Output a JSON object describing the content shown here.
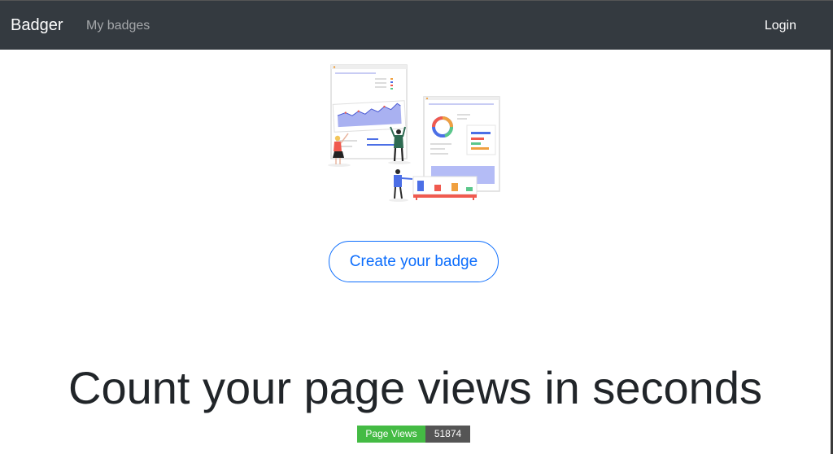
{
  "navbar": {
    "brand": "Badger",
    "links": [
      {
        "label": "My badges"
      }
    ],
    "login_label": "Login",
    "background": "#343a40"
  },
  "hero": {
    "illustration": "dashboard-people-illustration",
    "cta_label": "Create your badge",
    "accent": "#0d6efd"
  },
  "headline": "Count your page views in seconds",
  "badge": {
    "label": "Page Views",
    "value": "51874",
    "label_color": "#44bb44",
    "value_color": "#555555"
  }
}
